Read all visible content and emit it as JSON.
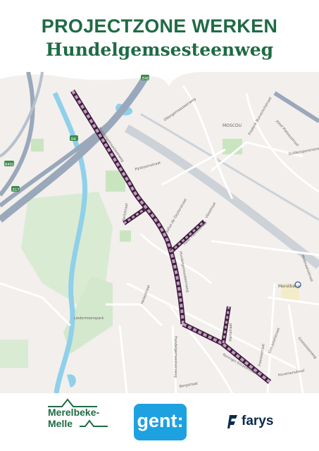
{
  "header": {
    "title_line1": "PROJECTZONE WERKEN",
    "title_line2": "Hundelgemsesteenweg"
  },
  "colors": {
    "brand_green": "#1f6b45",
    "route_purple": "#a8639e",
    "gent_blue": "#1da1e0",
    "farys_navy": "#0a2b4a",
    "water_blue": "#7ec8e3",
    "park_green": "#cfe8c8"
  },
  "map": {
    "labels": {
      "moscou": "MOSCOU",
      "merelbeke_station": "Merelbeke",
      "liedermeerspark": "Liedermeerspark",
      "hundelgemsesteenweg_a": "Hundelgemsesteenweg",
      "hundelgemsesteenweg_b": "Hundelgemsesteenweg",
      "hundelgemsesteenweg_c": "Hundelgemsesteenweg",
      "kerkstraat": "Kerkstraat",
      "pater_paulusstraat": "Pater Paulusstraat",
      "julius_de_geyterstraat": "Julius de Geyterstraat",
      "vlasstraat": "Vlasstraat",
      "hertstraat": "Hertstraat",
      "koningin_elisabethlaan": "Koningin Elisabethlaan",
      "pijnboomstraat": "Pijnboomstraat",
      "ottergemsesteenweg": "Ottergemsesteenweg",
      "frederik_burvenichstraat": "Frederik Burvenichstraat",
      "guldensporenstraat": "Guldensporenstraat",
      "jozef_plateaustraat": "Jozef Plateaustraat",
      "molenaarsstraat": "Molenaarsstraat",
      "hoveniersdreef": "Hoveniersdreef",
      "freesiastraat": "Freesiastraat",
      "sint_jozefstraat": "Sint-Jozefstraat",
      "grotesteenweg": "Grotesteenweg",
      "heikestraat": "Heikestraat",
      "bergstraat": "Bergstraat",
      "e40": "E40",
      "r4": "R4",
      "b401": "B401",
      "e17": "E17"
    },
    "icons": [
      "railway-station-icon",
      "highway-shield-icon"
    ]
  },
  "footer": {
    "merelbeke_line1": "Merelbeke-",
    "merelbeke_line2": "Melle",
    "gent_label": "gent:",
    "farys_label": "farys"
  }
}
